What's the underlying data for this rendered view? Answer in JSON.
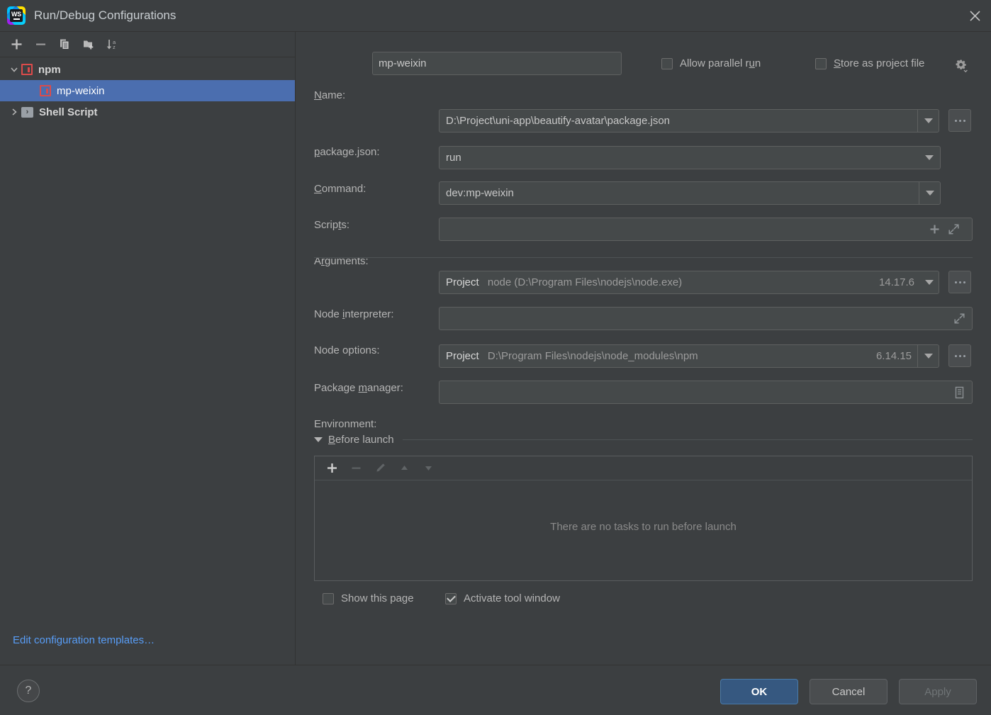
{
  "window": {
    "title": "Run/Debug Configurations",
    "app_icon": "webstorm-logo",
    "ws_initials": "WS",
    "close_label": "×"
  },
  "left_panel": {
    "toolbar": [
      {
        "name": "add-configuration-button",
        "glyph": "+",
        "enabled": true
      },
      {
        "name": "remove-configuration-button",
        "glyph": "−",
        "enabled": true
      },
      {
        "name": "copy-configuration-button",
        "glyph": "copy-icon",
        "enabled": true
      },
      {
        "name": "new-folder-button",
        "glyph": "folder-add-icon",
        "enabled": true
      },
      {
        "name": "sort-configurations-button",
        "glyph": "sort-az-icon",
        "enabled": true
      }
    ],
    "tree": [
      {
        "label": "npm",
        "icon": "npm-icon",
        "expanded": true,
        "twisty": "chevron-down",
        "selected": false,
        "level": 0
      },
      {
        "label": "mp-weixin",
        "icon": "npm-icon",
        "expanded": false,
        "twisty": "",
        "selected": true,
        "level": 1
      },
      {
        "label": "Shell Script",
        "icon": "shell-script-icon",
        "expanded": false,
        "twisty": "chevron-right",
        "selected": false,
        "level": 0
      }
    ],
    "edit_templates_link": "Edit configuration templates…"
  },
  "form": {
    "name": {
      "label_pre": "",
      "label_mnemonic": "N",
      "label_post": "ame:",
      "value": "mp-weixin"
    },
    "allow_parallel_run": {
      "label_pre": "Allow parallel r",
      "label_mnemonic": "u",
      "label_post": "n",
      "checked": false
    },
    "store_as_project_file": {
      "label_pre": "",
      "label_mnemonic": "S",
      "label_post": "tore as project file",
      "checked": false,
      "gear_icon": "gear-dropdown-icon"
    },
    "package_json": {
      "label_pre": "",
      "label_mnemonic": "p",
      "label_post": "ackage.json:",
      "value": "D:\\Project\\uni-app\\beautify-avatar\\package.json",
      "browse_label": "..."
    },
    "command": {
      "label_pre": "",
      "label_mnemonic": "C",
      "label_post": "ommand:",
      "value": "run"
    },
    "scripts": {
      "label_pre": "Scrip",
      "label_mnemonic": "t",
      "label_post": "s:",
      "value": "dev:mp-weixin"
    },
    "arguments": {
      "label_pre": "A",
      "label_mnemonic": "r",
      "label_post": "guments:",
      "value": "",
      "icons": [
        "insert-macro-icon",
        "expand-icon"
      ]
    },
    "node_interpreter": {
      "label_pre": "Node ",
      "label_mnemonic": "i",
      "label_post": "nterpreter:",
      "prefix": "Project",
      "value": "node (D:\\Program Files\\nodejs\\node.exe)",
      "version": "14.17.6",
      "browse_label": "..."
    },
    "node_options": {
      "label_pre": "Node options:",
      "label_mnemonic": "",
      "label_post": "",
      "value": "",
      "icons": [
        "expand-icon"
      ]
    },
    "package_manager": {
      "label_pre": "Package ",
      "label_mnemonic": "m",
      "label_post": "anager:",
      "prefix": "Project",
      "value": "D:\\Program Files\\nodejs\\node_modules\\npm",
      "version": "6.14.15",
      "browse_label": "..."
    },
    "environment": {
      "label_pre": "Environment:",
      "label_mnemonic": "",
      "label_post": "",
      "value": "",
      "icons": [
        "environment-variables-icon"
      ]
    }
  },
  "before_launch": {
    "title_pre": "",
    "title_mnemonic": "B",
    "title_post": "efore launch",
    "expanded": true,
    "toolbar": [
      {
        "name": "add-task-button",
        "glyph": "+",
        "enabled": true
      },
      {
        "name": "remove-task-button",
        "glyph": "−",
        "enabled": false
      },
      {
        "name": "edit-task-button",
        "glyph": "pencil-icon",
        "enabled": false
      },
      {
        "name": "move-task-up-button",
        "glyph": "triangle-up-icon",
        "enabled": false
      },
      {
        "name": "move-task-down-button",
        "glyph": "triangle-down-icon",
        "enabled": false
      }
    ],
    "empty_text": "There are no tasks to run before launch",
    "show_this_page": {
      "label": "Show this page",
      "checked": false
    },
    "activate_tool_window": {
      "label": "Activate tool window",
      "checked": true
    }
  },
  "footer": {
    "help_label": "?",
    "ok_label": "OK",
    "cancel_label": "Cancel",
    "apply_label": "Apply",
    "apply_enabled": false
  },
  "colors": {
    "background": "#3c3f41",
    "field_background": "#45494a",
    "selection_blue": "#4b6eaf",
    "link_blue": "#589df6",
    "primary_button": "#365880",
    "npm_red": "#db4b4b",
    "text": "#b4b4b4",
    "muted_text": "#9b9b9b"
  }
}
